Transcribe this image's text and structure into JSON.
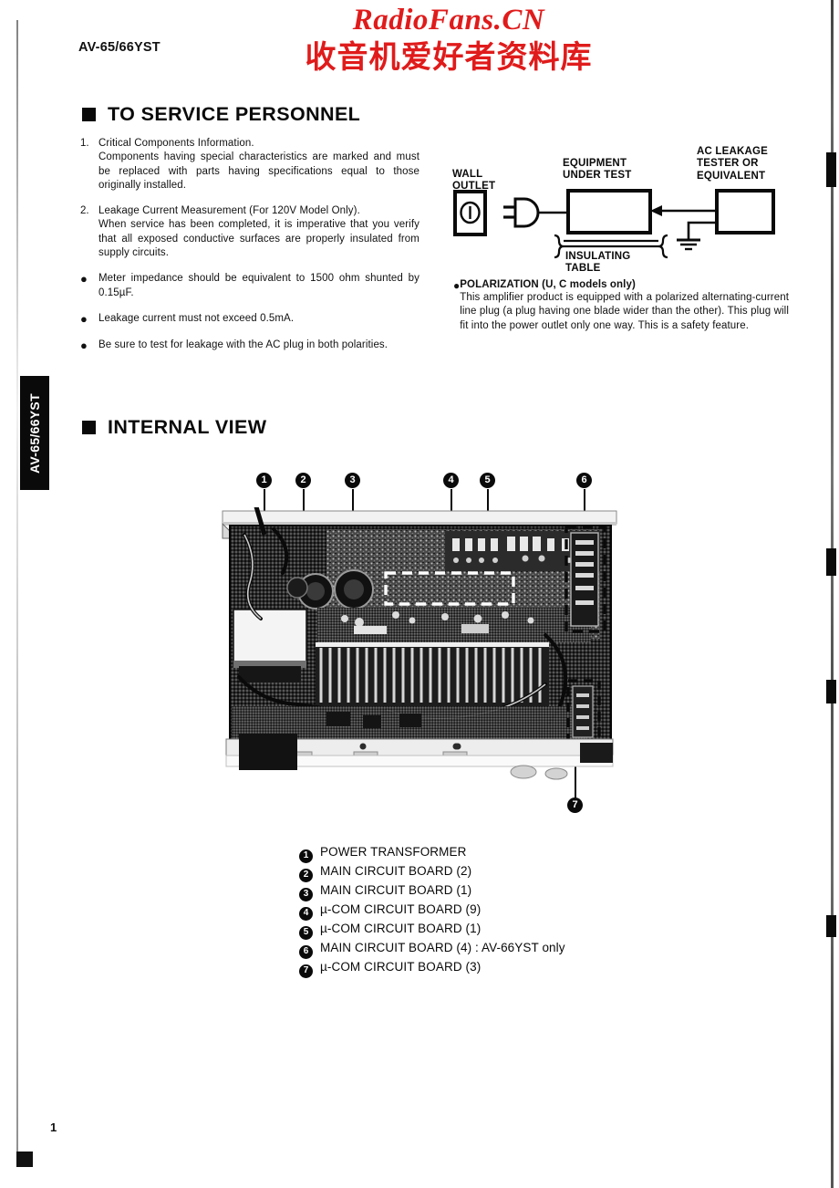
{
  "page": {
    "model_code": "AV-65/66YST",
    "page_number": "1",
    "side_tab_label": "AV-65/66YST"
  },
  "watermark": {
    "english": "RadioFans.CN",
    "chinese": "收音机爱好者资料库",
    "color": "#e01b1b"
  },
  "sections": {
    "service": {
      "heading": "TO SERVICE PERSONNEL",
      "items": [
        {
          "marker": "1.",
          "type": "numbered",
          "first_line": "Critical Components Information.",
          "text": "Components having special characteristics are marked and must be replaced with parts having specifications equal to those originally installed."
        },
        {
          "marker": "2.",
          "type": "numbered",
          "first_line": "Leakage Current Measurement (For 120V Model Only).",
          "text": "When service has been completed, it is imperative that you verify that all exposed conductive surfaces are properly insulated from supply circuits."
        },
        {
          "marker": "●",
          "type": "bulleted",
          "first_line": "",
          "text": "Meter impedance should be equivalent to 1500 ohm shunted by 0.15µF."
        },
        {
          "marker": "●",
          "type": "bulleted",
          "first_line": "",
          "text": "Leakage current must not exceed 0.5mA."
        },
        {
          "marker": "●",
          "type": "bulleted",
          "first_line": "",
          "text": "Be sure to test for leakage with the AC plug in both polarities."
        }
      ]
    },
    "polarization": {
      "marker": "●",
      "title": "POLARIZATION (U, C models only)",
      "text": "This amplifier product is equipped with a polarized alternating-current line plug (a plug having one blade wider than the other). This plug will fit into the power outlet only one way. This is a safety feature."
    },
    "internal_view": {
      "heading": "INTERNAL VIEW"
    }
  },
  "diagram": {
    "labels": {
      "wall_outlet": "WALL\nOUTLET",
      "equipment_under_test": "EQUIPMENT\nUNDER TEST",
      "ac_leakage_tester": "AC  LEAKAGE\nTESTER  OR\nEQUIVALENT",
      "insulating_table": "INSULATING\nTABLE"
    }
  },
  "legend": {
    "items": [
      {
        "number": "1",
        "label": "POWER TRANSFORMER"
      },
      {
        "number": "2",
        "label": "MAIN CIRCUIT BOARD (2)"
      },
      {
        "number": "3",
        "label": "MAIN CIRCUIT BOARD (1)"
      },
      {
        "number": "4",
        "label": "µ-COM CIRCUIT BOARD (9)"
      },
      {
        "number": "5",
        "label": "µ-COM CIRCUIT BOARD (1)"
      },
      {
        "number": "6",
        "label": "MAIN CIRCUIT BOARD (4) : AV-66YST only"
      },
      {
        "number": "7",
        "label": "µ-COM CIRCUIT BOARD (3)"
      }
    ]
  },
  "callouts": [
    {
      "number": "1"
    },
    {
      "number": "2"
    },
    {
      "number": "3"
    },
    {
      "number": "4"
    },
    {
      "number": "5"
    },
    {
      "number": "6"
    },
    {
      "number": "7"
    }
  ]
}
